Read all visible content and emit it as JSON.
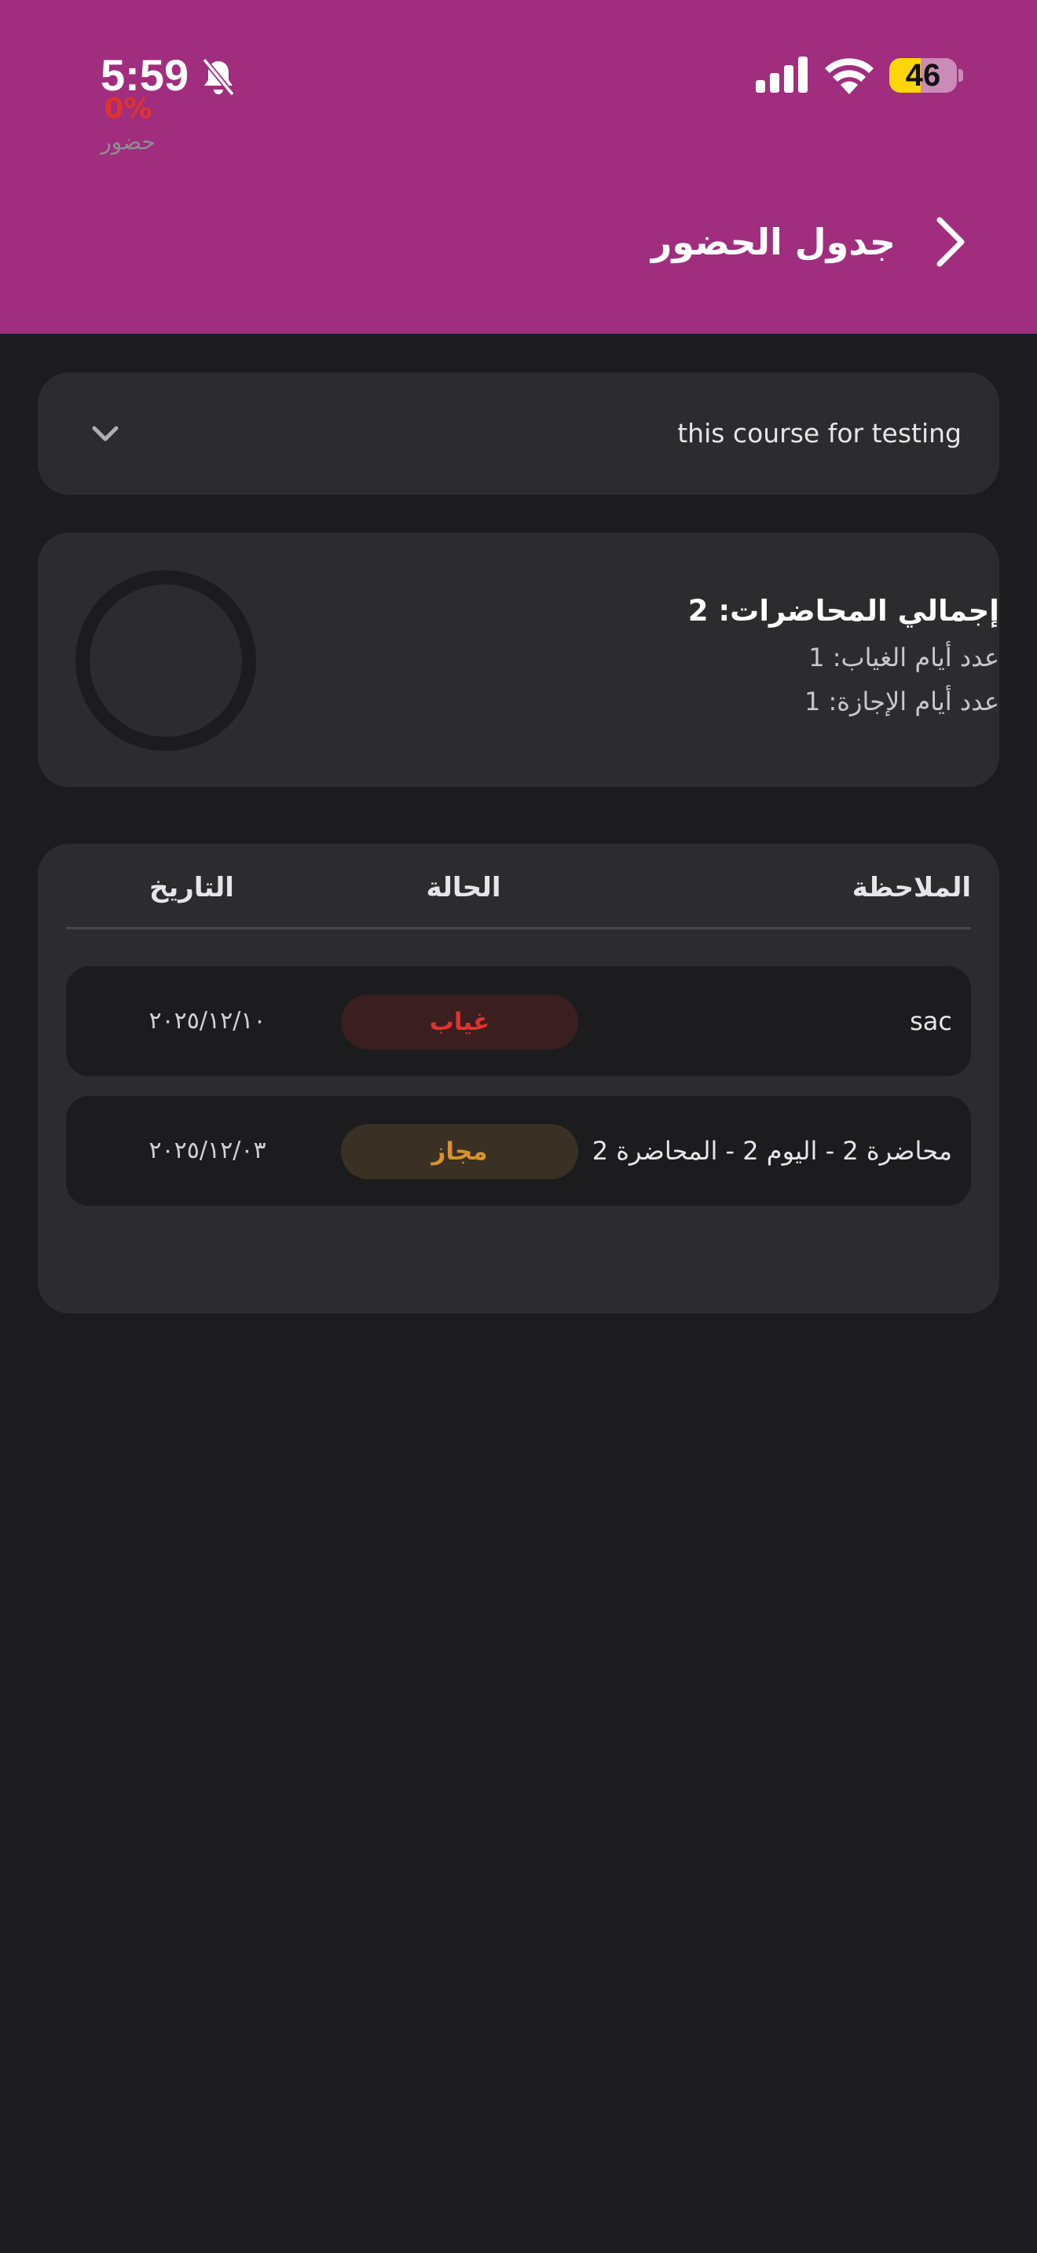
{
  "status_bar": {
    "time": "5:59",
    "battery_level": "46",
    "battery_fraction": 0.46
  },
  "header": {
    "title": "جدول الحضور"
  },
  "course_selector": {
    "selected": "this course for testing"
  },
  "summary": {
    "attendance_percent": "0%",
    "attendance_caption": "حضور",
    "attendance_fraction": 0,
    "total_lectures": "إجمالي المحاضرات: 2",
    "absence_days": "عدد أيام الغياب: 1",
    "leave_days": "عدد أيام الإجازة: 1"
  },
  "table": {
    "columns": {
      "note": "الملاحظة",
      "status": "الحالة",
      "date": "التاريخ"
    },
    "rows": [
      {
        "note": "sac",
        "status": "غياب",
        "date": "٢٠٢٥/١٢/١٠"
      },
      {
        "note": "محاضرة 2 - اليوم 2 - المحاضرة 2",
        "status": "مجاز",
        "date": "٢٠٢٥/١٢/٠٣"
      }
    ]
  },
  "colors": {
    "header_bg": "#a02d7e",
    "page_bg": "#1c1c1e",
    "card_bg": "#2c2c2e",
    "absent": "#e0332e",
    "excused": "#d9922b"
  }
}
